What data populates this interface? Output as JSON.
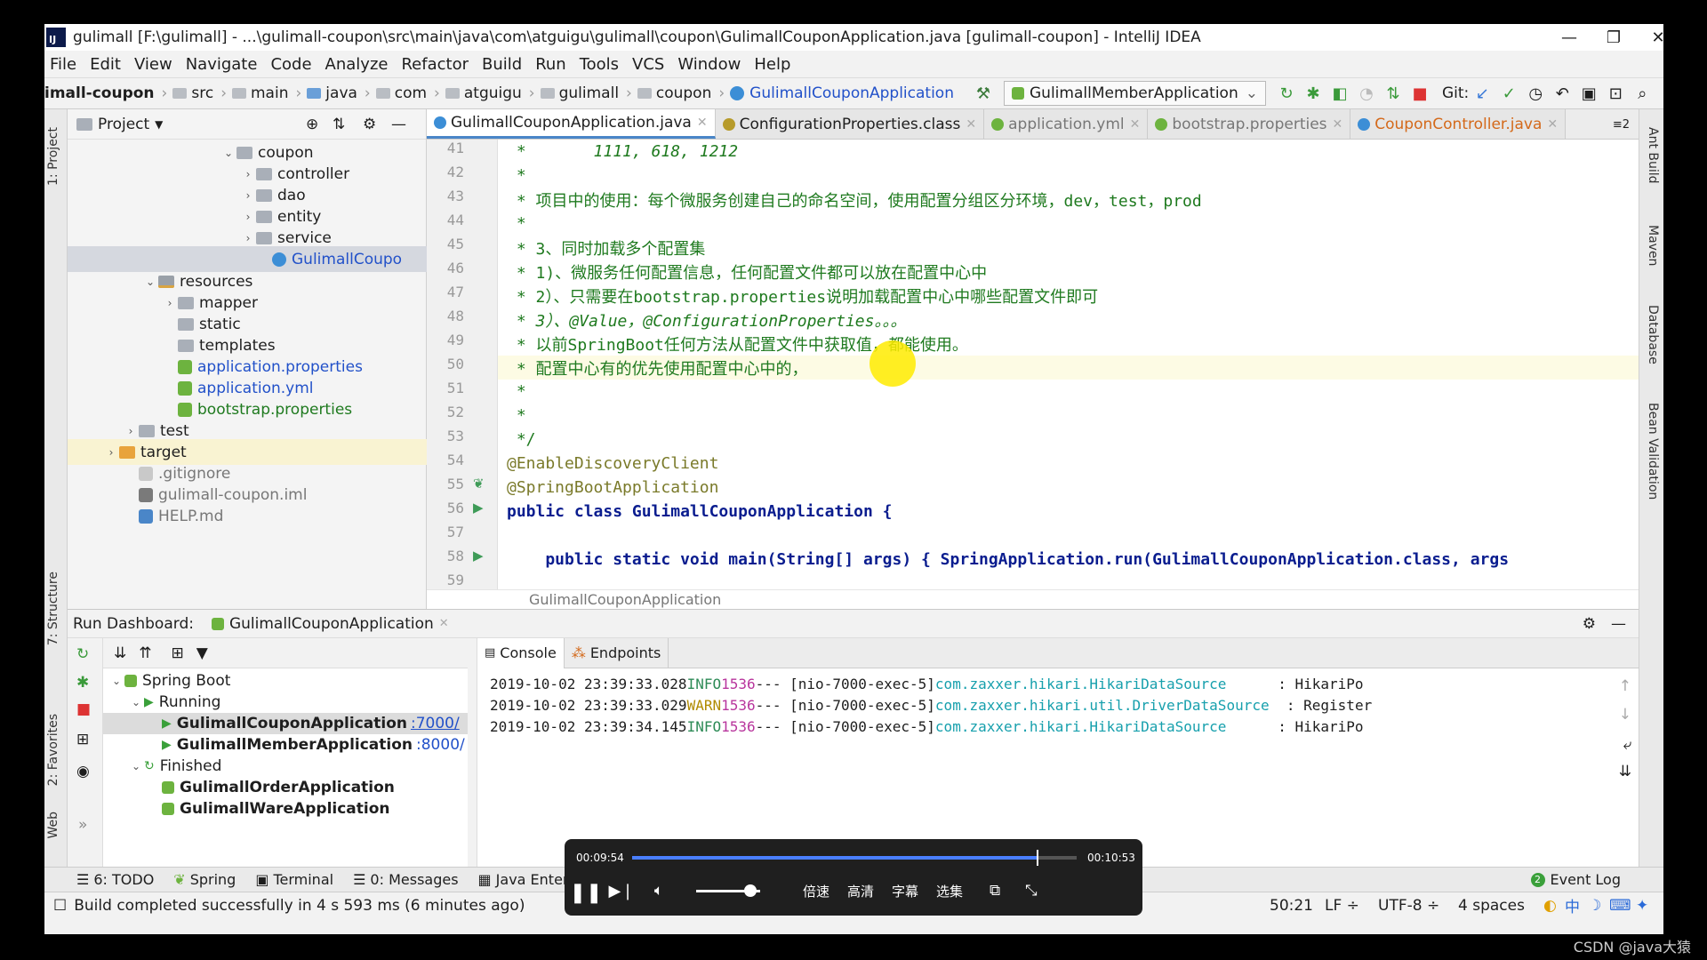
{
  "window": {
    "title": "gulimall [F:\\gulimall] - ...\\gulimall-coupon\\src\\main\\java\\com\\atguigu\\gulimall\\coupon\\GulimallCouponApplication.java [gulimall-coupon] - IntelliJ IDEA",
    "minimize": "—",
    "restore": "❐",
    "close": "✕",
    "logo": "IJ"
  },
  "menu": [
    "File",
    "Edit",
    "View",
    "Navigate",
    "Code",
    "Analyze",
    "Refactor",
    "Build",
    "Run",
    "Tools",
    "VCS",
    "Window",
    "Help"
  ],
  "nav": {
    "crumbs": [
      "imall-coupon",
      "src",
      "main",
      "java",
      "com",
      "atguigu",
      "gulimall",
      "coupon",
      "GulimallCouponApplication"
    ],
    "run_config": "GulimallMemberApplication",
    "git_label": "Git:"
  },
  "project": {
    "header": "Project",
    "items": [
      {
        "label": "coupon",
        "indent": 0
      },
      {
        "label": "controller"
      },
      {
        "label": "dao"
      },
      {
        "label": "entity"
      },
      {
        "label": "service"
      },
      {
        "label": "GulimallCoupo"
      },
      {
        "label": "resources"
      },
      {
        "label": "mapper"
      },
      {
        "label": "static"
      },
      {
        "label": "templates"
      },
      {
        "label": "application.properties"
      },
      {
        "label": "application.yml"
      },
      {
        "label": "bootstrap.properties"
      },
      {
        "label": "test"
      },
      {
        "label": "target"
      },
      {
        "label": ".gitignore"
      },
      {
        "label": "gulimall-coupon.iml"
      },
      {
        "label": "HELP.md"
      }
    ]
  },
  "editor": {
    "tabs": [
      "GulimallCouponApplication.java",
      "ConfigurationProperties.class",
      "application.yml",
      "bootstrap.properties",
      "CouponController.java"
    ],
    "tab_count": "≡2",
    "lines": [
      {
        "n": "41",
        "t": " *       1111, 618, 1212"
      },
      {
        "n": "42",
        "t": " *"
      },
      {
        "n": "43",
        "t": " * 项目中的使用：每个微服务创建自己的命名空间，使用配置分组区分环境，dev，test，prod"
      },
      {
        "n": "44",
        "t": " *"
      },
      {
        "n": "45",
        "t": " * 3、同时加载多个配置集"
      },
      {
        "n": "46",
        "t": " * 1)、微服务任何配置信息，任何配置文件都可以放在配置中心中"
      },
      {
        "n": "47",
        "t": " * 2）、只需要在bootstrap.properties说明加载配置中心中哪些配置文件即可"
      },
      {
        "n": "48",
        "t": " * 3）、@Value，@ConfigurationProperties。。。"
      },
      {
        "n": "49",
        "t": " * 以前SpringBoot任何方法从配置文件中获取值，都能使用。"
      },
      {
        "n": "50",
        "t": " * 配置中心有的优先使用配置中心中的，"
      },
      {
        "n": "51",
        "t": " *"
      },
      {
        "n": "52",
        "t": " *"
      },
      {
        "n": "53",
        "t": " */"
      },
      {
        "n": "54",
        "t": "@EnableDiscoveryClient"
      },
      {
        "n": "55",
        "t": "@SpringBootApplication"
      },
      {
        "n": "56",
        "t": "public class GulimallCouponApplication {"
      },
      {
        "n": "57",
        "t": ""
      },
      {
        "n": "58",
        "t": "    public static void main(String[] args) { SpringApplication.run(GulimallCouponApplication.class, args"
      },
      {
        "n": "59",
        "t": ""
      }
    ],
    "breadcrumb": "GulimallCouponApplication"
  },
  "run": {
    "title": "Run Dashboard:",
    "config": "GulimallCouponApplication",
    "tree": [
      {
        "label": "Spring Boot"
      },
      {
        "label": "Running"
      },
      {
        "label": "GulimallCouponApplication",
        "port": ":7000/"
      },
      {
        "label": "GulimallMemberApplication",
        "port": ":8000/"
      },
      {
        "label": "Finished"
      },
      {
        "label": "GulimallOrderApplication"
      },
      {
        "label": "GulimallWareApplication"
      }
    ],
    "console_tabs": [
      "Console",
      "Endpoints"
    ],
    "logs": [
      {
        "ts": "2019-10-02 23:39:33.028",
        "lvl": "INFO",
        "pid": "1536",
        "th": "--- [nio-7000-exec-5]",
        "logger": "com.zaxxer.hikari.HikariDataSource",
        "msg": "      : HikariPo"
      },
      {
        "ts": "2019-10-02 23:39:33.029",
        "lvl": "WARN",
        "pid": "1536",
        "th": "--- [nio-7000-exec-5]",
        "logger": "com.zaxxer.hikari.util.DriverDataSource",
        "msg": "  : Register"
      },
      {
        "ts": "2019-10-02 23:39:34.145",
        "lvl": "INFO",
        "pid": "1536",
        "th": "--- [nio-7000-exec-5]",
        "logger": "com.zaxxer.hikari.HikariDataSource",
        "msg": "      : HikariPo"
      }
    ]
  },
  "bottom_tabs": [
    "6: TODO",
    "Spring",
    "Terminal",
    "0: Messages",
    "Java Enter"
  ],
  "event_log": "Event Log",
  "status": {
    "message": "Build completed successfully in 4 s 593 ms (6 minutes ago)",
    "pos": "50:21",
    "lf": "LF ÷",
    "enc": "UTF-8 ÷",
    "indent": "4 spaces"
  },
  "side_tabs": {
    "left": [
      "1: Project",
      "7: Structure",
      "2: Favorites",
      "Web"
    ],
    "right": [
      "Ant Build",
      "Maven",
      "Database",
      "Bean Validation"
    ]
  },
  "player": {
    "current": "00:09:54",
    "total": "00:10:53",
    "progress": 0.909,
    "volume": 0.85,
    "buttons": [
      "倍速",
      "高清",
      "字幕",
      "选集"
    ]
  },
  "watermark": "CSDN @java大猿",
  "colors": {
    "accent": "#4a86c8",
    "comment": "#1f7a1f",
    "keyword": "#0a1d8f"
  }
}
